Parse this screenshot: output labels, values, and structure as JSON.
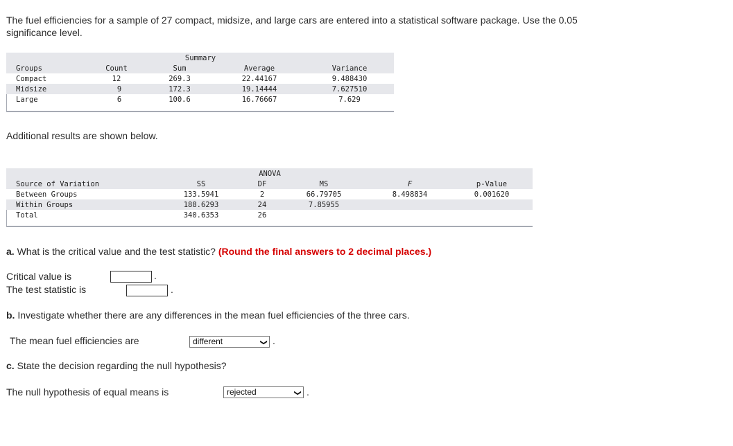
{
  "intro": {
    "line1": "The fuel efficiencies for a sample of 27 compact, midsize, and large cars are entered into a statistical software package. Use the 0.05",
    "line2": "significance level."
  },
  "summary": {
    "title": "Summary",
    "headers": [
      "Groups",
      "Count",
      "Sum",
      "Average",
      "Variance"
    ],
    "rows": [
      [
        "Compact",
        "12",
        "269.3",
        "22.44167",
        "9.488430"
      ],
      [
        "Midsize",
        "9",
        "172.3",
        "19.14444",
        "7.627510"
      ],
      [
        "Large",
        "6",
        "100.6",
        "16.76667",
        "7.629"
      ]
    ]
  },
  "additional_text": "Additional results are shown below.",
  "anova": {
    "title": "ANOVA",
    "headers": [
      "Source of Variation",
      "SS",
      "DF",
      "MS",
      "F",
      "p-Value"
    ],
    "rows": [
      [
        "Between Groups",
        "133.5941",
        "2",
        "66.79705",
        "8.498834",
        "0.001620"
      ],
      [
        "Within Groups",
        "188.6293",
        "24",
        "7.85955",
        "",
        ""
      ],
      [
        "Total",
        "340.6353",
        "26",
        "",
        "",
        ""
      ]
    ]
  },
  "part_a": {
    "letter": "a.",
    "question": "What is the critical value and the test statistic?",
    "round_note": "(Round the final answers to 2 decimal places.)",
    "critical_label": "Critical value is",
    "critical_value": "",
    "statistic_label": "The test statistic is",
    "statistic_value": ""
  },
  "part_b": {
    "letter": "b.",
    "question": "Investigate whether there are any differences in the mean fuel efficiencies of the three cars.",
    "answer_label": "The mean fuel efficiencies are",
    "answer_selected": "different"
  },
  "part_c": {
    "letter": "c.",
    "question": "State the decision regarding the null hypothesis?",
    "answer_label": "The null hypothesis of equal means is",
    "answer_selected": "rejected"
  },
  "period": "."
}
